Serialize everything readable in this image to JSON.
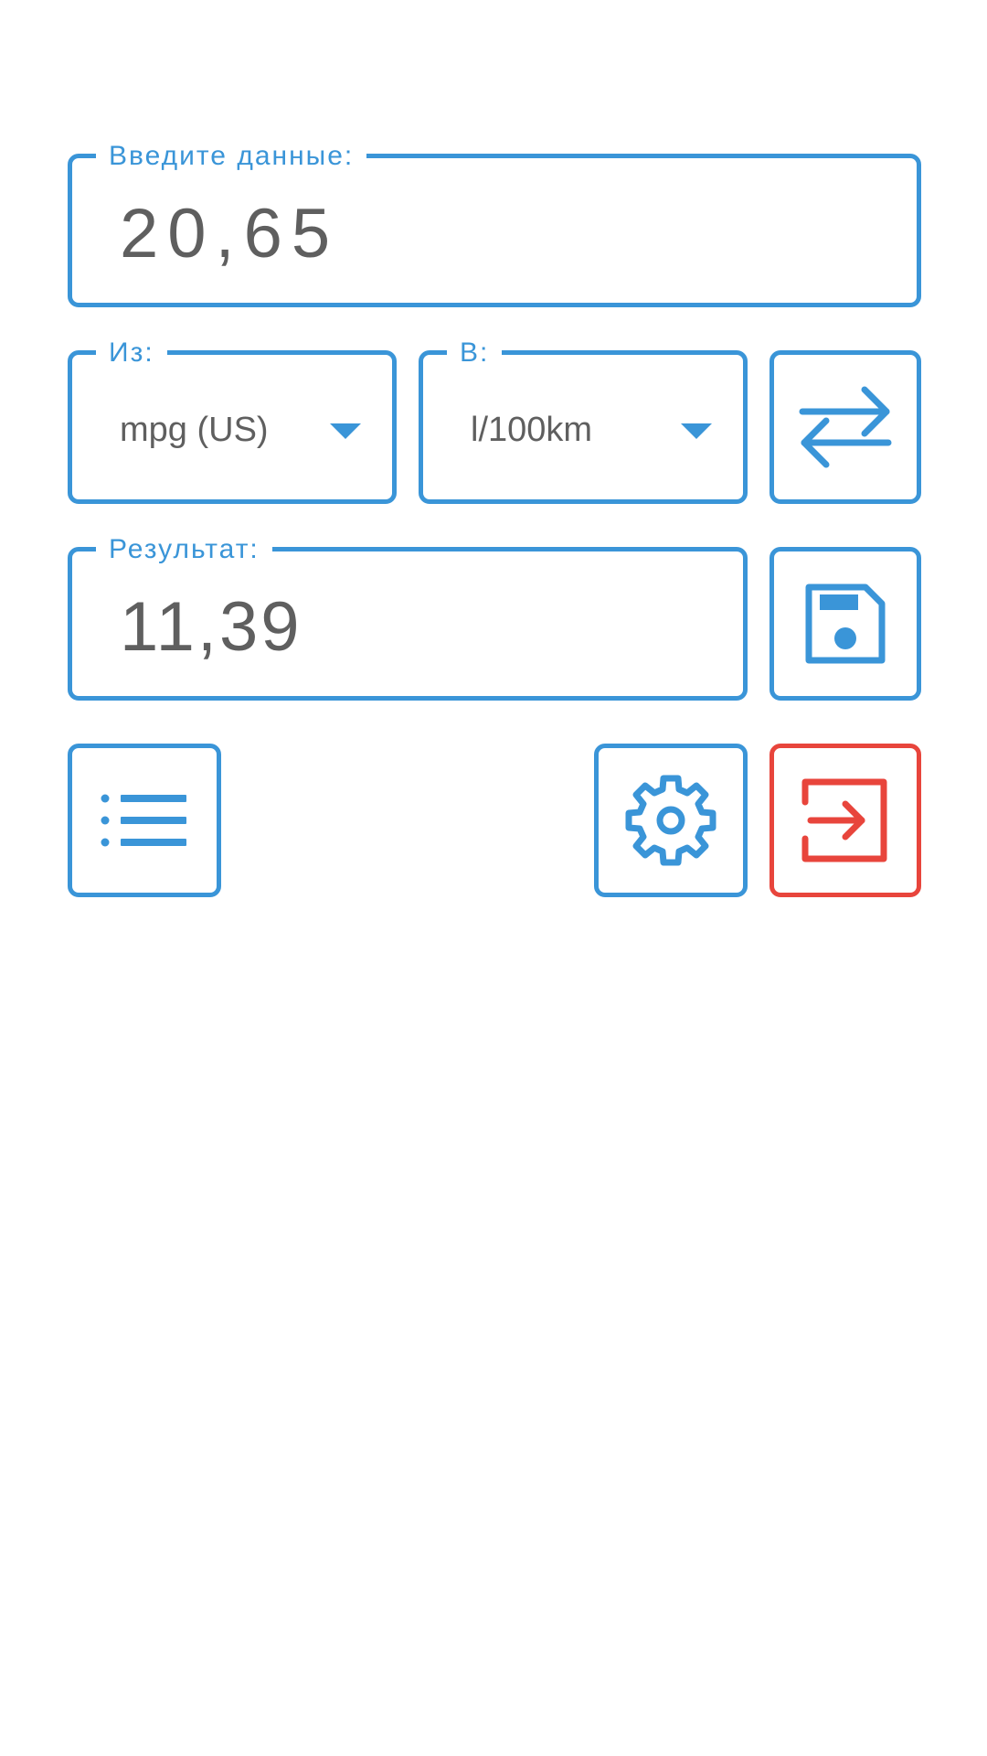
{
  "input": {
    "label": "Введите данные:",
    "value": "20,65"
  },
  "from_unit": {
    "label": "Из:",
    "value": "mpg (US)"
  },
  "to_unit": {
    "label": "В:",
    "value": "l/100km"
  },
  "result": {
    "label": "Результат:",
    "value": "11,39"
  },
  "icons": {
    "swap": "swap-arrows-icon",
    "save": "floppy-disk-icon",
    "history": "list-icon",
    "settings": "gear-icon",
    "exit": "exit-icon"
  },
  "colors": {
    "accent": "#3a95d8",
    "danger": "#e8453c",
    "text": "#5f5f5f",
    "background": "#ffffff"
  }
}
